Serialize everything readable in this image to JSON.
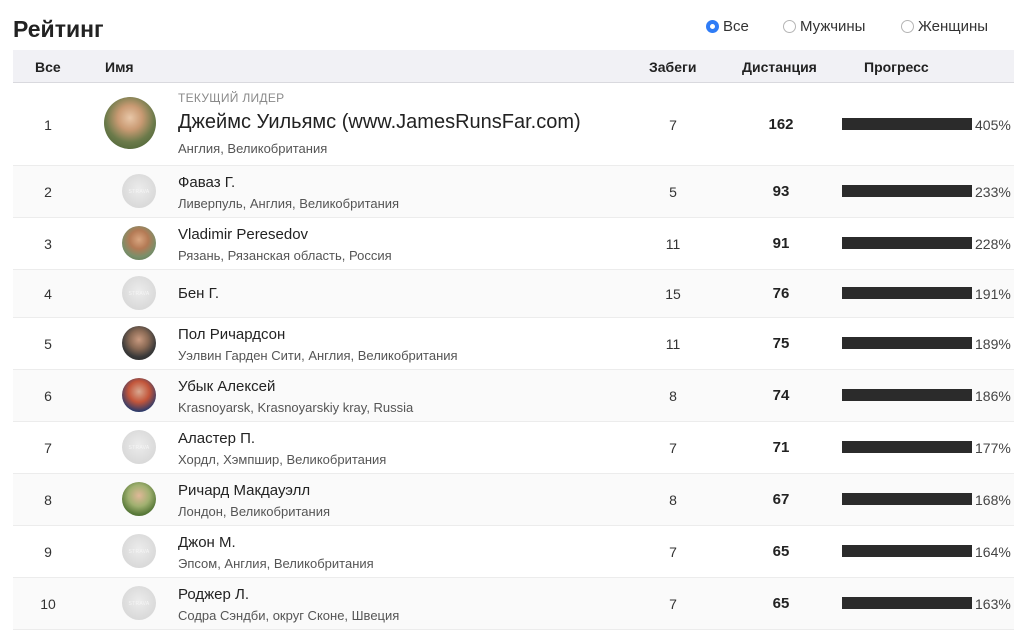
{
  "title": "Рейтинг",
  "filters": [
    {
      "label": "Все",
      "checked": true
    },
    {
      "label": "Мужчины",
      "checked": false
    },
    {
      "label": "Женщины",
      "checked": false
    }
  ],
  "columns": {
    "rank": "Все",
    "name": "Имя",
    "runs": "Забеги",
    "distance": "Дистанция",
    "progress": "Прогресс"
  },
  "leader_tag": "ТЕКУЩИЙ ЛИДЕР",
  "rows": [
    {
      "rank": "1",
      "name": "Джеймс Уильямс (www.JamesRunsFar.com)",
      "location": "Англия, Великобритания",
      "runs": "7",
      "distance": "162",
      "progress": "405%",
      "avatar": "photo"
    },
    {
      "rank": "2",
      "name": "Фаваз Г.",
      "location": "Ливерпуль, Англия, Великобритания",
      "runs": "5",
      "distance": "93",
      "progress": "233%",
      "avatar": "placeholder"
    },
    {
      "rank": "3",
      "name": "Vladimir Peresedov",
      "location": "Рязань, Рязанская область, Россия",
      "runs": "11",
      "distance": "91",
      "progress": "228%",
      "avatar": "photo"
    },
    {
      "rank": "4",
      "name": "Бен Г.",
      "location": "",
      "runs": "15",
      "distance": "76",
      "progress": "191%",
      "avatar": "placeholder"
    },
    {
      "rank": "5",
      "name": "Пол Ричардсон",
      "location": "Уэлвин Гарден Сити, Англия, Великобритания",
      "runs": "11",
      "distance": "75",
      "progress": "189%",
      "avatar": "photo"
    },
    {
      "rank": "6",
      "name": "Убык Алексей",
      "location": "Krasnoyarsk, Krasnoyarskiy kray, Russia",
      "runs": "8",
      "distance": "74",
      "progress": "186%",
      "avatar": "photo"
    },
    {
      "rank": "7",
      "name": "Аластер П.",
      "location": "Хордл, Хэмпшир, Великобритания",
      "runs": "7",
      "distance": "71",
      "progress": "177%",
      "avatar": "placeholder"
    },
    {
      "rank": "8",
      "name": "Ричард Макдауэлл",
      "location": "Лондон, Великобритания",
      "runs": "8",
      "distance": "67",
      "progress": "168%",
      "avatar": "photo"
    },
    {
      "rank": "9",
      "name": "Джон М.",
      "location": "Эпсом, Англия, Великобритания",
      "runs": "7",
      "distance": "65",
      "progress": "164%",
      "avatar": "placeholder"
    },
    {
      "rank": "10",
      "name": "Роджер Л.",
      "location": "Содра Сэндби, округ Сконе, Швеция",
      "runs": "7",
      "distance": "65",
      "progress": "163%",
      "avatar": "placeholder"
    }
  ]
}
